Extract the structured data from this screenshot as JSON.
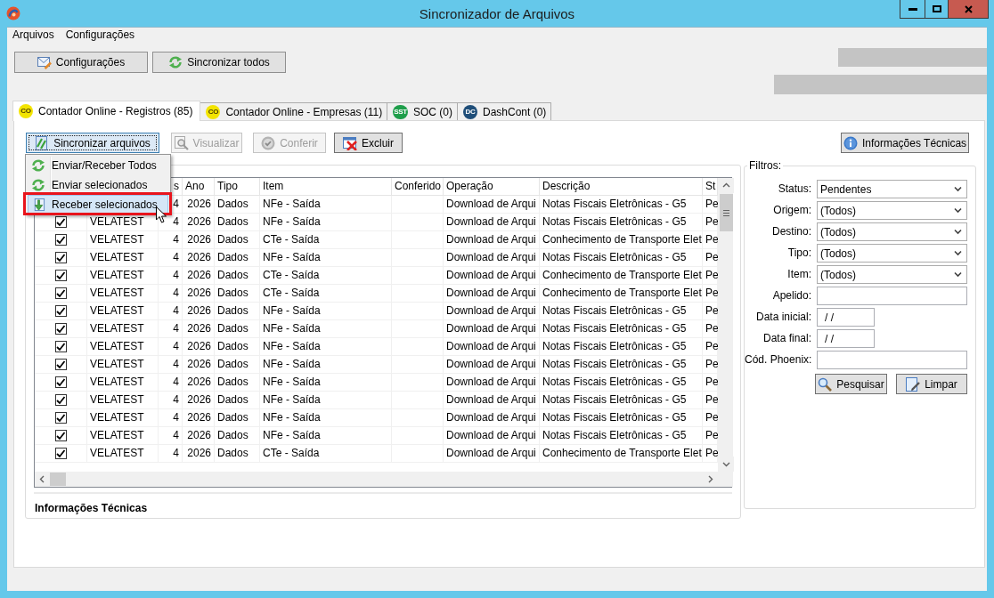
{
  "window": {
    "title": "Sincronizador de Arquivos"
  },
  "menu_bar": [
    "Arquivos",
    "Configurações"
  ],
  "toolbar": [
    {
      "label": "Configurações"
    },
    {
      "label": "Sincronizar todos"
    }
  ],
  "tabs": [
    {
      "label": "Contador Online - Registros (85)",
      "logo_text": "CO",
      "color": "#f3e400",
      "selected": true
    },
    {
      "label": "Contador Online - Empresas (11)",
      "logo_text": "CO",
      "color": "#f3e400",
      "selected": false
    },
    {
      "label": "SOC (0)",
      "logo_text": "SST",
      "color": "#1e9e4a",
      "selected": false
    },
    {
      "label": "DashCont (0)",
      "logo_text": "DC",
      "color": "#1f4e79",
      "selected": false
    }
  ],
  "panel": {
    "actions": [
      {
        "label": "Sincronizar arquivos",
        "disabled": false,
        "active": true
      },
      {
        "label": "Visualizar",
        "disabled": true,
        "active": false
      },
      {
        "label": "Conferir",
        "disabled": true,
        "active": false
      },
      {
        "label": "Excluir",
        "disabled": false,
        "active": false
      }
    ],
    "info_button": {
      "label": "Informações Técnicas"
    },
    "context_menu": [
      {
        "label": "Enviar/Receber Todos",
        "selected": false,
        "outlined": false
      },
      {
        "label": "Enviar selecionados",
        "selected": false,
        "outlined": false
      },
      {
        "label": "Receber selecionados",
        "selected": true,
        "outlined": true
      }
    ],
    "table": {
      "columns": [
        "s",
        "Ano",
        "Tipo",
        "Item",
        "Conferido",
        "Operação",
        "Descrição",
        "St"
      ],
      "rows": [
        {
          "column_3": "4",
          "ano": "2026",
          "tipo": "Dados",
          "item": "NFe - Saída",
          "operacao": "Download de Arqui",
          "descricao": "Notas Fiscais Eletrônicas - G5",
          "column_10": "Pe"
        },
        {
          "checked": true,
          "column_2": "VELATEST",
          "column_3": "4",
          "ano": "2026",
          "tipo": "Dados",
          "item": "NFe - Saída",
          "operacao": "Download de Arqui",
          "descricao": "Notas Fiscais Eletrônicas - G5",
          "column_10": "Pe"
        },
        {
          "checked": true,
          "column_2": "VELATEST",
          "column_3": "4",
          "ano": "2026",
          "tipo": "Dados",
          "item": "CTe - Saída",
          "operacao": "Download de Arqui",
          "descricao": "Conhecimento de Transporte Elet",
          "column_10": "Pe"
        },
        {
          "checked": true,
          "column_2": "VELATEST",
          "column_3": "4",
          "ano": "2026",
          "tipo": "Dados",
          "item": "NFe - Saída",
          "operacao": "Download de Arqui",
          "descricao": "Notas Fiscais Eletrônicas - G5",
          "column_10": "Pe"
        },
        {
          "checked": true,
          "column_2": "VELATEST",
          "column_3": "4",
          "ano": "2026",
          "tipo": "Dados",
          "item": "CTe - Saída",
          "operacao": "Download de Arqui",
          "descricao": "Conhecimento de Transporte Elet",
          "column_10": "Pe"
        },
        {
          "checked": true,
          "column_2": "VELATEST",
          "column_3": "4",
          "ano": "2026",
          "tipo": "Dados",
          "item": "CTe - Saída",
          "operacao": "Download de Arqui",
          "descricao": "Conhecimento de Transporte Elet",
          "column_10": "Pe"
        },
        {
          "checked": true,
          "column_2": "VELATEST",
          "column_3": "4",
          "ano": "2026",
          "tipo": "Dados",
          "item": "NFe - Saída",
          "operacao": "Download de Arqui",
          "descricao": "Notas Fiscais Eletrônicas - G5",
          "column_10": "Pe"
        },
        {
          "checked": true,
          "column_2": "VELATEST",
          "column_3": "4",
          "ano": "2026",
          "tipo": "Dados",
          "item": "NFe - Saída",
          "operacao": "Download de Arqui",
          "descricao": "Notas Fiscais Eletrônicas - G5",
          "column_10": "Pe"
        },
        {
          "checked": true,
          "column_2": "VELATEST",
          "column_3": "4",
          "ano": "2026",
          "tipo": "Dados",
          "item": "NFe - Saída",
          "operacao": "Download de Arqui",
          "descricao": "Notas Fiscais Eletrônicas - G5",
          "column_10": "Pe"
        },
        {
          "checked": true,
          "column_2": "VELATEST",
          "column_3": "4",
          "ano": "2026",
          "tipo": "Dados",
          "item": "NFe - Saída",
          "operacao": "Download de Arqui",
          "descricao": "Notas Fiscais Eletrônicas - G5",
          "column_10": "Pe"
        },
        {
          "checked": true,
          "column_2": "VELATEST",
          "column_3": "4",
          "ano": "2026",
          "tipo": "Dados",
          "item": "NFe - Saída",
          "operacao": "Download de Arqui",
          "descricao": "Notas Fiscais Eletrônicas - G5",
          "column_10": "Pe"
        },
        {
          "checked": true,
          "column_2": "VELATEST",
          "column_3": "4",
          "ano": "2026",
          "tipo": "Dados",
          "item": "NFe - Saída",
          "operacao": "Download de Arqui",
          "descricao": "Notas Fiscais Eletrônicas - G5",
          "column_10": "Pe"
        },
        {
          "checked": true,
          "column_2": "VELATEST",
          "column_3": "4",
          "ano": "2026",
          "tipo": "Dados",
          "item": "NFe - Saída",
          "operacao": "Download de Arqui",
          "descricao": "Notas Fiscais Eletrônicas - G5",
          "column_10": "Pe"
        },
        {
          "checked": true,
          "column_2": "VELATEST",
          "column_3": "4",
          "ano": "2026",
          "tipo": "Dados",
          "item": "NFe - Saída",
          "operacao": "Download de Arqui",
          "descricao": "Notas Fiscais Eletrônicas - G5",
          "column_10": "Pe"
        },
        {
          "checked": true,
          "column_2": "VELATEST",
          "column_3": "4",
          "ano": "2026",
          "tipo": "Dados",
          "item": "CTe - Saída",
          "operacao": "Download de Arqui",
          "descricao": "Conhecimento de Transporte Elet",
          "column_10": "Pe"
        }
      ]
    },
    "details_panel": {
      "title": "Informações Técnicas"
    },
    "filters": {
      "title": "Filtros:",
      "fields": [
        {
          "kind": "select",
          "label": "Status:",
          "value": "Pendentes"
        },
        {
          "kind": "select",
          "label": "Origem:",
          "value": "(Todos)"
        },
        {
          "kind": "select",
          "label": "Destino:",
          "value": "(Todos)"
        },
        {
          "kind": "select",
          "label": "Tipo:",
          "value": "(Todos)"
        },
        {
          "kind": "select",
          "label": "Item:",
          "value": "(Todos)"
        },
        {
          "kind": "text",
          "label": "Apelido:"
        },
        {
          "kind": "date",
          "label": "Data inicial:",
          "value": "/ /"
        },
        {
          "kind": "date",
          "label": "Data final:",
          "value": "/ /"
        },
        {
          "kind": "text",
          "label": "Cód. Phoenix:"
        }
      ],
      "buttons": [
        {
          "label": "Pesquisar"
        },
        {
          "label": "Limpar"
        }
      ]
    }
  }
}
